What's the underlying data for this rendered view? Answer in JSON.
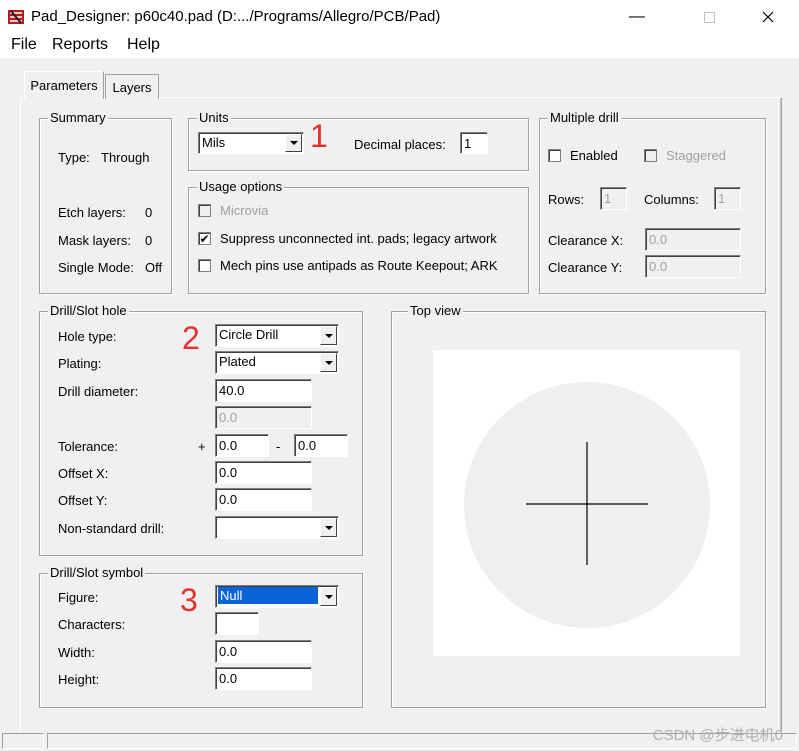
{
  "window": {
    "title": "Pad_Designer: p60c40.pad (D:.../Programs/Allegro/PCB/Pad)",
    "minimize_icon": "minimize-icon",
    "maximize_icon": "maximize-icon",
    "close_icon": "close-icon"
  },
  "menu": {
    "items": [
      "File",
      "Reports",
      "Help"
    ]
  },
  "tabs": [
    {
      "label": "Parameters",
      "active": true
    },
    {
      "label": "Layers",
      "active": false
    }
  ],
  "summary": {
    "title": "Summary",
    "type_label": "Type:",
    "type_value": "Through",
    "etch_label": "Etch layers:",
    "etch_value": "0",
    "mask_label": "Mask layers:",
    "mask_value": "0",
    "single_label": "Single Mode:",
    "single_value": "Off"
  },
  "units": {
    "title": "Units",
    "selected": "Mils",
    "decimal_label": "Decimal places:",
    "decimal_value": "1"
  },
  "usage": {
    "title": "Usage options",
    "microvia_label": "Microvia",
    "microvia_checked": false,
    "suppress_label": "Suppress unconnected int. pads; legacy artwork",
    "suppress_checked": true,
    "mech_label": "Mech pins use antipads as Route Keepout; ARK",
    "mech_checked": false
  },
  "multiple_drill": {
    "title": "Multiple drill",
    "enabled_label": "Enabled",
    "staggered_label": "Staggered",
    "rows_label": "Rows:",
    "rows_value": "1",
    "columns_label": "Columns:",
    "columns_value": "1",
    "clearance_x_label": "Clearance X:",
    "clearance_x_value": "0.0",
    "clearance_y_label": "Clearance Y:",
    "clearance_y_value": "0.0"
  },
  "drill_hole": {
    "title": "Drill/Slot hole",
    "hole_type_label": "Hole type:",
    "hole_type_value": "Circle Drill",
    "plating_label": "Plating:",
    "plating_value": "Plated",
    "diameter_label": "Drill diameter:",
    "diameter_value": "40.0",
    "secondary_value": "0.0",
    "tolerance_label": "Tolerance:",
    "plus": "+",
    "minus": "-",
    "tol_plus_value": "0.0",
    "tol_minus_value": "0.0",
    "offset_x_label": "Offset X:",
    "offset_x_value": "0.0",
    "offset_y_label": "Offset Y:",
    "offset_y_value": "0.0",
    "nonstandard_label": "Non-standard drill:",
    "nonstandard_value": ""
  },
  "drill_symbol": {
    "title": "Drill/Slot symbol",
    "figure_label": "Figure:",
    "figure_value": "Null",
    "characters_label": "Characters:",
    "characters_value": "",
    "width_label": "Width:",
    "width_value": "0.0",
    "height_label": "Height:",
    "height_value": "0.0"
  },
  "top_view": {
    "title": "Top view"
  },
  "annotations": [
    "1",
    "2",
    "3"
  ],
  "watermark": "CSDN @步进电机0",
  "colors": {
    "annotation": "#e8302b",
    "selection": "#0a64d8",
    "pad_circle": "#efefef"
  }
}
